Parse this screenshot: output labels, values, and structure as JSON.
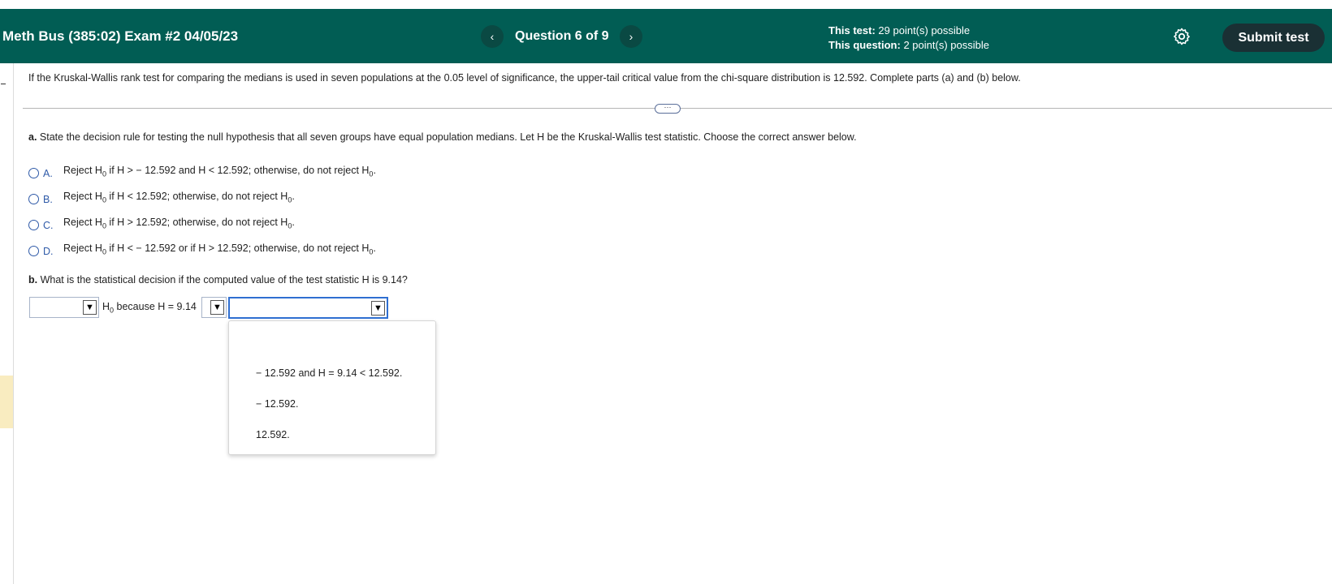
{
  "header": {
    "exam_title": "Meth Bus (385:02) Exam #2 04/05/23",
    "question_label": "Question 6 of 9",
    "prev_icon": "chevron-left-icon",
    "next_icon": "chevron-right-icon",
    "this_test_label": "This test:",
    "this_test_value": "29 point(s) possible",
    "this_question_label": "This question:",
    "this_question_value": "2 point(s) possible",
    "settings_icon": "gear-icon",
    "submit_label": "Submit test",
    "colors": {
      "header_bg": "#015d54",
      "submit_bg": "#1a3034"
    }
  },
  "question": {
    "text": "If the Kruskal-Wallis rank test for comparing the medians is used in seven populations at the 0.05 level of significance, the upper-tail critical value from the chi-square distribution is 12.592. Complete parts (a) and (b) below.",
    "more_label": "···"
  },
  "part_a": {
    "prefix": "a.",
    "text": " State the decision rule for testing the null hypothesis that all seven groups have equal population medians. Let H be the Kruskal-Wallis test statistic. Choose the correct answer below.",
    "options": [
      {
        "letter": "A.",
        "pre": "Reject H",
        "sub": "0",
        "post": " if H >  − 12.592 and H < 12.592; otherwise, do not reject H",
        "end_sub": "0",
        "end": "."
      },
      {
        "letter": "B.",
        "pre": "Reject H",
        "sub": "0",
        "post": " if H < 12.592; otherwise, do not reject H",
        "end_sub": "0",
        "end": "."
      },
      {
        "letter": "C.",
        "pre": "Reject H",
        "sub": "0",
        "post": " if H > 12.592; otherwise, do not reject H",
        "end_sub": "0",
        "end": "."
      },
      {
        "letter": "D.",
        "pre": "Reject H",
        "sub": "0",
        "post": " if H <  − 12.592 or if H > 12.592; otherwise, do not reject H",
        "end_sub": "0",
        "end": "."
      }
    ]
  },
  "part_b": {
    "prefix": "b.",
    "text": " What is the statistical decision if the computed value of the test statistic H is 9.14?",
    "h": "H",
    "h_sub": "0",
    "because": " because H = 9.14",
    "dropdown1_value": "",
    "dropdown2_value": "",
    "dropdown3_value": "",
    "menu_items": [
      "− 12.592 and H = 9.14 < 12.592.",
      "− 12.592.",
      "12.592."
    ]
  }
}
